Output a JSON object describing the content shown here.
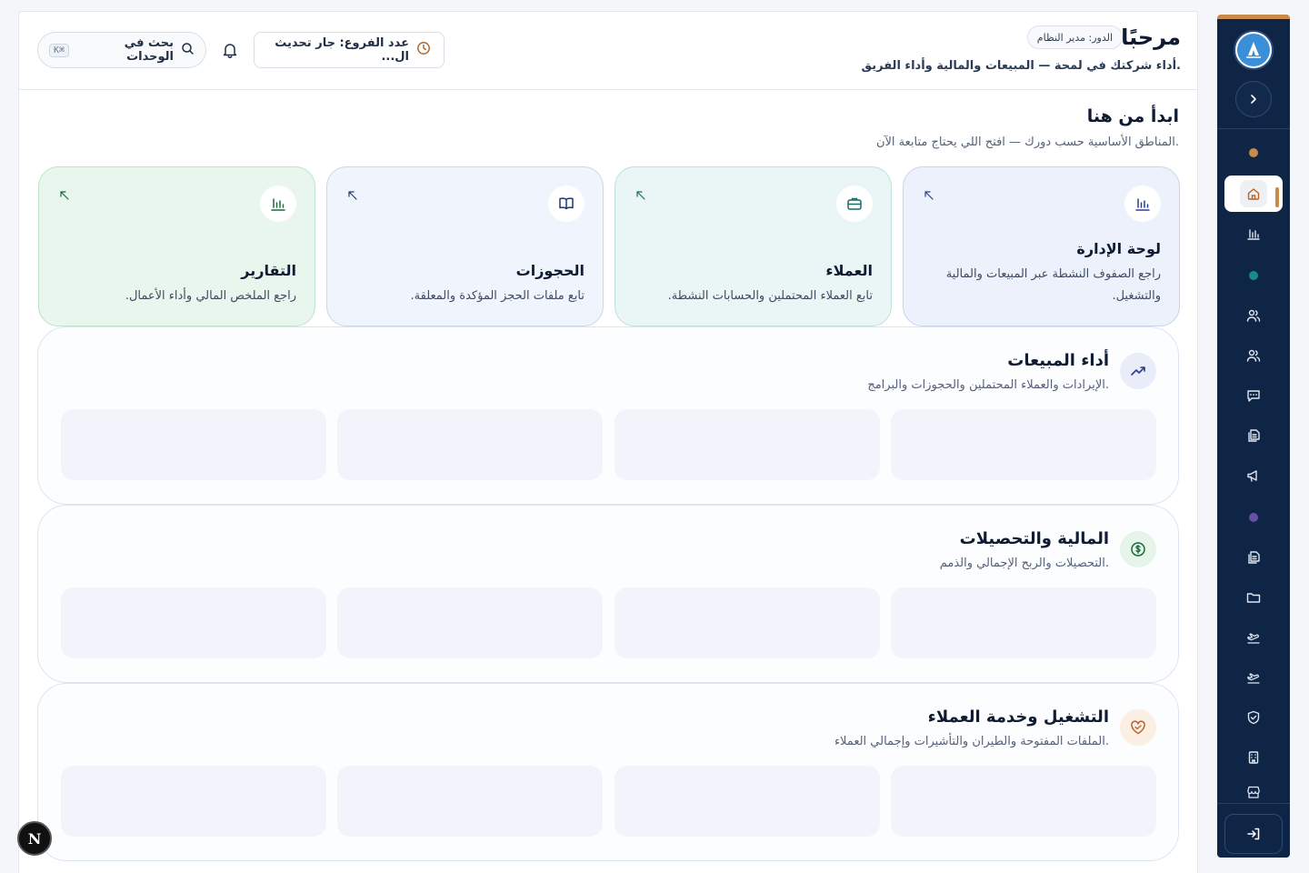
{
  "header": {
    "greeting": "مرحبًا",
    "role": "الدور: مدير النظام",
    "subtitle": "أداء شركتك في لمحة — المبيعات والمالية وأداء الفريق.",
    "branch_label": "عدد الفروع: جار تحديث ال...",
    "search_label": "بحث في الوحدات",
    "search_shortcut": "K⌘"
  },
  "start": {
    "title": "ابدأ من هنا",
    "subtitle": "المناطق الأساسية حسب دورك — افتح اللي يحتاج متابعة الآن."
  },
  "quick_cards": [
    {
      "title": "لوحة الإدارة",
      "desc": "راجع الصفوف النشطة عبر المبيعات والمالية والتشغيل.",
      "icon": "bar-chart-icon"
    },
    {
      "title": "العملاء",
      "desc": "تابع العملاء المحتملين والحسابات النشطة.",
      "icon": "briefcase-icon"
    },
    {
      "title": "الحجوزات",
      "desc": "تابع ملفات الحجز المؤكدة والمعلقة.",
      "icon": "book-icon"
    },
    {
      "title": "التقارير",
      "desc": "راجع الملخص المالي وأداء الأعمال.",
      "icon": "bar-chart-icon"
    }
  ],
  "sections": [
    {
      "title": "أداء المبيعات",
      "subtitle": "الإيرادات والعملاء المحتملين والحجوزات والبرامج.",
      "icon": "trending-up-icon",
      "color": "#2a3f8f"
    },
    {
      "title": "المالية والتحصيلات",
      "subtitle": "التحصيلات والربح الإجمالي والذمم.",
      "icon": "dollar-icon",
      "color": "#1a6a3a"
    },
    {
      "title": "التشغيل وخدمة العملاء",
      "subtitle": "الملفات المفتوحة والطيران والتأشيرات وإجمالي العملاء.",
      "icon": "heart-handshake-icon",
      "color": "#b5652a"
    }
  ],
  "sidebar": {
    "dot_colors": [
      "#c98a4a",
      "#1a8a8a",
      "#6a4fa8"
    ],
    "accent": "#c98a4a"
  },
  "next_badge": "N"
}
